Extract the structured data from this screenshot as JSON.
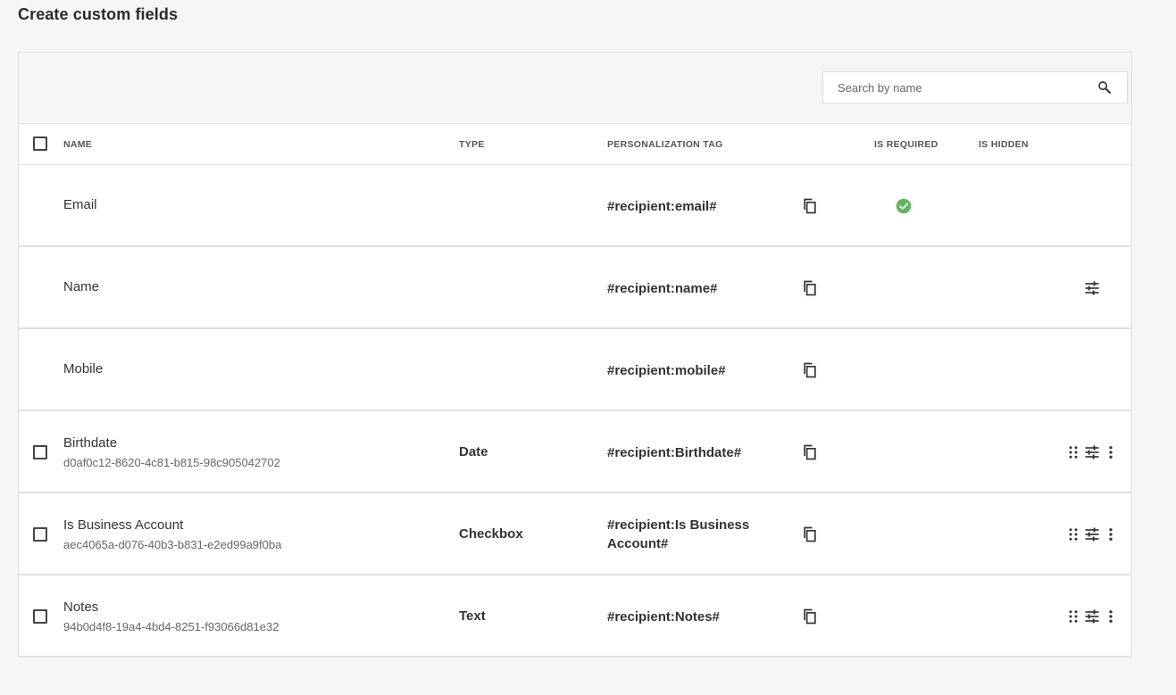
{
  "page": {
    "title": "Create custom fields"
  },
  "search": {
    "placeholder": "Search by name",
    "value": ""
  },
  "table": {
    "columns": {
      "name": "NAME",
      "type": "TYPE",
      "tag": "PERSONALIZATION TAG",
      "required": "IS REQUIRED",
      "hidden": "IS HIDDEN"
    },
    "rows": [
      {
        "name": "Email",
        "id": "",
        "type": "",
        "tag": "#recipient:email#",
        "required": true,
        "selectable": false,
        "actions": []
      },
      {
        "name": "Name",
        "id": "",
        "type": "",
        "tag": "#recipient:name#",
        "required": false,
        "selectable": false,
        "actions": [
          "settings"
        ]
      },
      {
        "name": "Mobile",
        "id": "",
        "type": "",
        "tag": "#recipient:mobile#",
        "required": false,
        "selectable": false,
        "actions": []
      },
      {
        "name": "Birthdate",
        "id": "d0af0c12-8620-4c81-b815-98c905042702",
        "type": "Date",
        "tag": "#recipient:Birthdate#",
        "required": false,
        "selectable": true,
        "actions": [
          "drag",
          "settings",
          "more"
        ]
      },
      {
        "name": "Is Business Account",
        "id": "aec4065a-d076-40b3-b831-e2ed99a9f0ba",
        "type": "Checkbox",
        "tag": "#recipient:Is Business Account#",
        "required": false,
        "selectable": true,
        "actions": [
          "drag",
          "settings",
          "more"
        ]
      },
      {
        "name": "Notes",
        "id": "94b0d4f8-19a4-4bd4-8251-f93066d81e32",
        "type": "Text",
        "tag": "#recipient:Notes#",
        "required": false,
        "selectable": true,
        "actions": [
          "drag",
          "settings",
          "more"
        ]
      }
    ]
  },
  "colors": {
    "required_check": "#5cb85c",
    "background": "#f6f6f6",
    "border": "#e0e0e0"
  },
  "icons": {
    "search": "search-icon",
    "copy": "copy-icon",
    "required": "check-circle-icon",
    "settings": "sliders-icon",
    "drag": "drag-handle-icon",
    "more": "more-vertical-icon"
  }
}
